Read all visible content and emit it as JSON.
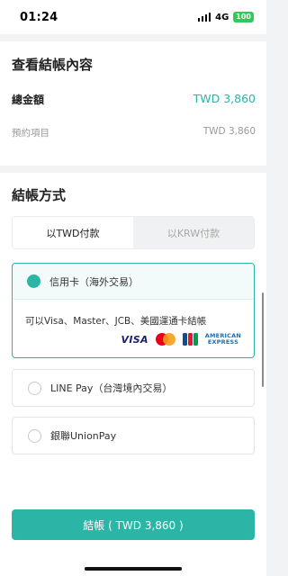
{
  "status_bar": {
    "time": "01:24",
    "network": "4G",
    "battery": "100"
  },
  "summary": {
    "title": "查看結帳內容",
    "total_label": "總金額",
    "total_value": "TWD 3,860",
    "item_label": "預約項目",
    "item_value": "TWD 3,860"
  },
  "payment": {
    "title": "結帳方式",
    "tabs": [
      {
        "label": "以TWD付款",
        "active": true
      },
      {
        "label": "以KRW付款",
        "active": false
      }
    ],
    "options": [
      {
        "label": "信用卡（海外交易）",
        "selected": true,
        "description": "可以Visa、Master、JCB、美國運通卡結帳",
        "cards": {
          "visa": "VISA",
          "amex_line1": "AMERICAN",
          "amex_line2": "EXPRESS"
        }
      },
      {
        "label": "LINE Pay（台灣境內交易）",
        "selected": false
      },
      {
        "label": "銀聯UnionPay",
        "selected": false
      }
    ]
  },
  "checkout_button": "結帳 ( TWD 3,860 )",
  "colors": {
    "accent": "#2bb5a6",
    "muted": "#9a9a9a",
    "background": "#f2f3f5"
  }
}
